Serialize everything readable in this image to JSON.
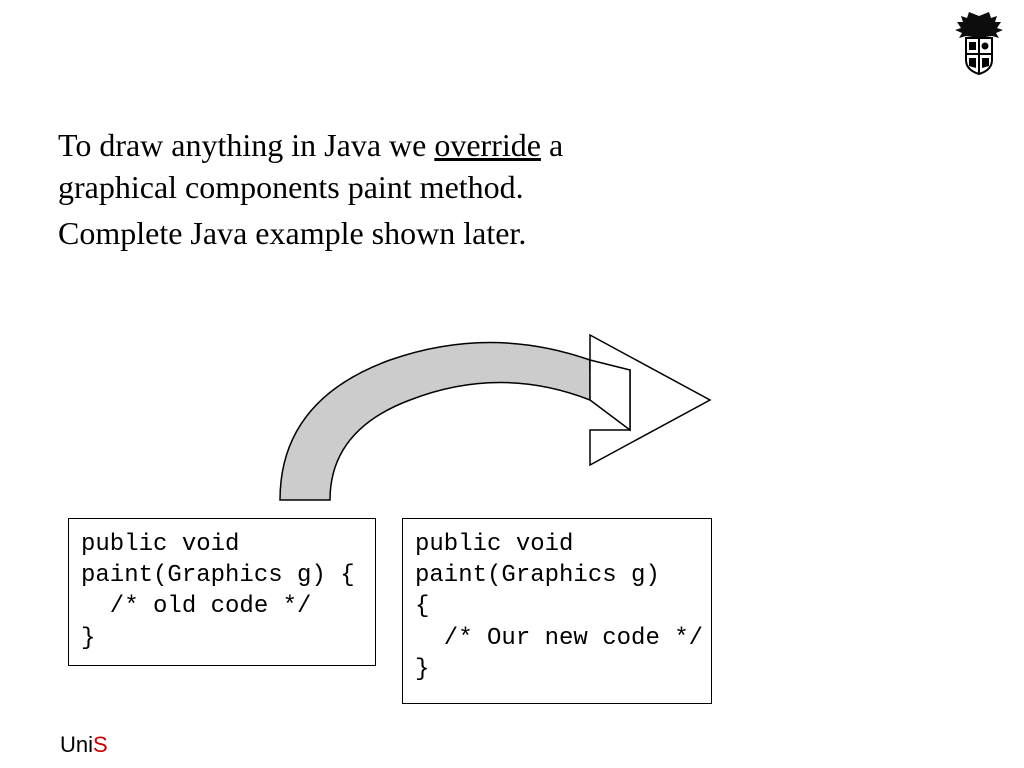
{
  "text": {
    "line1_part1": "To draw anything in Java we ",
    "line1_underlined": "override",
    "line1_part2": " a",
    "line2": "graphical components paint method.",
    "line3": "Complete Java example shown later."
  },
  "code": {
    "left": "public void\npaint(Graphics g) {\n  /* old code */\n}",
    "right": "public void\npaint(Graphics g)\n{\n  /* Our new code */\n}"
  },
  "footer": {
    "uni": "Uni",
    "s": "S"
  }
}
